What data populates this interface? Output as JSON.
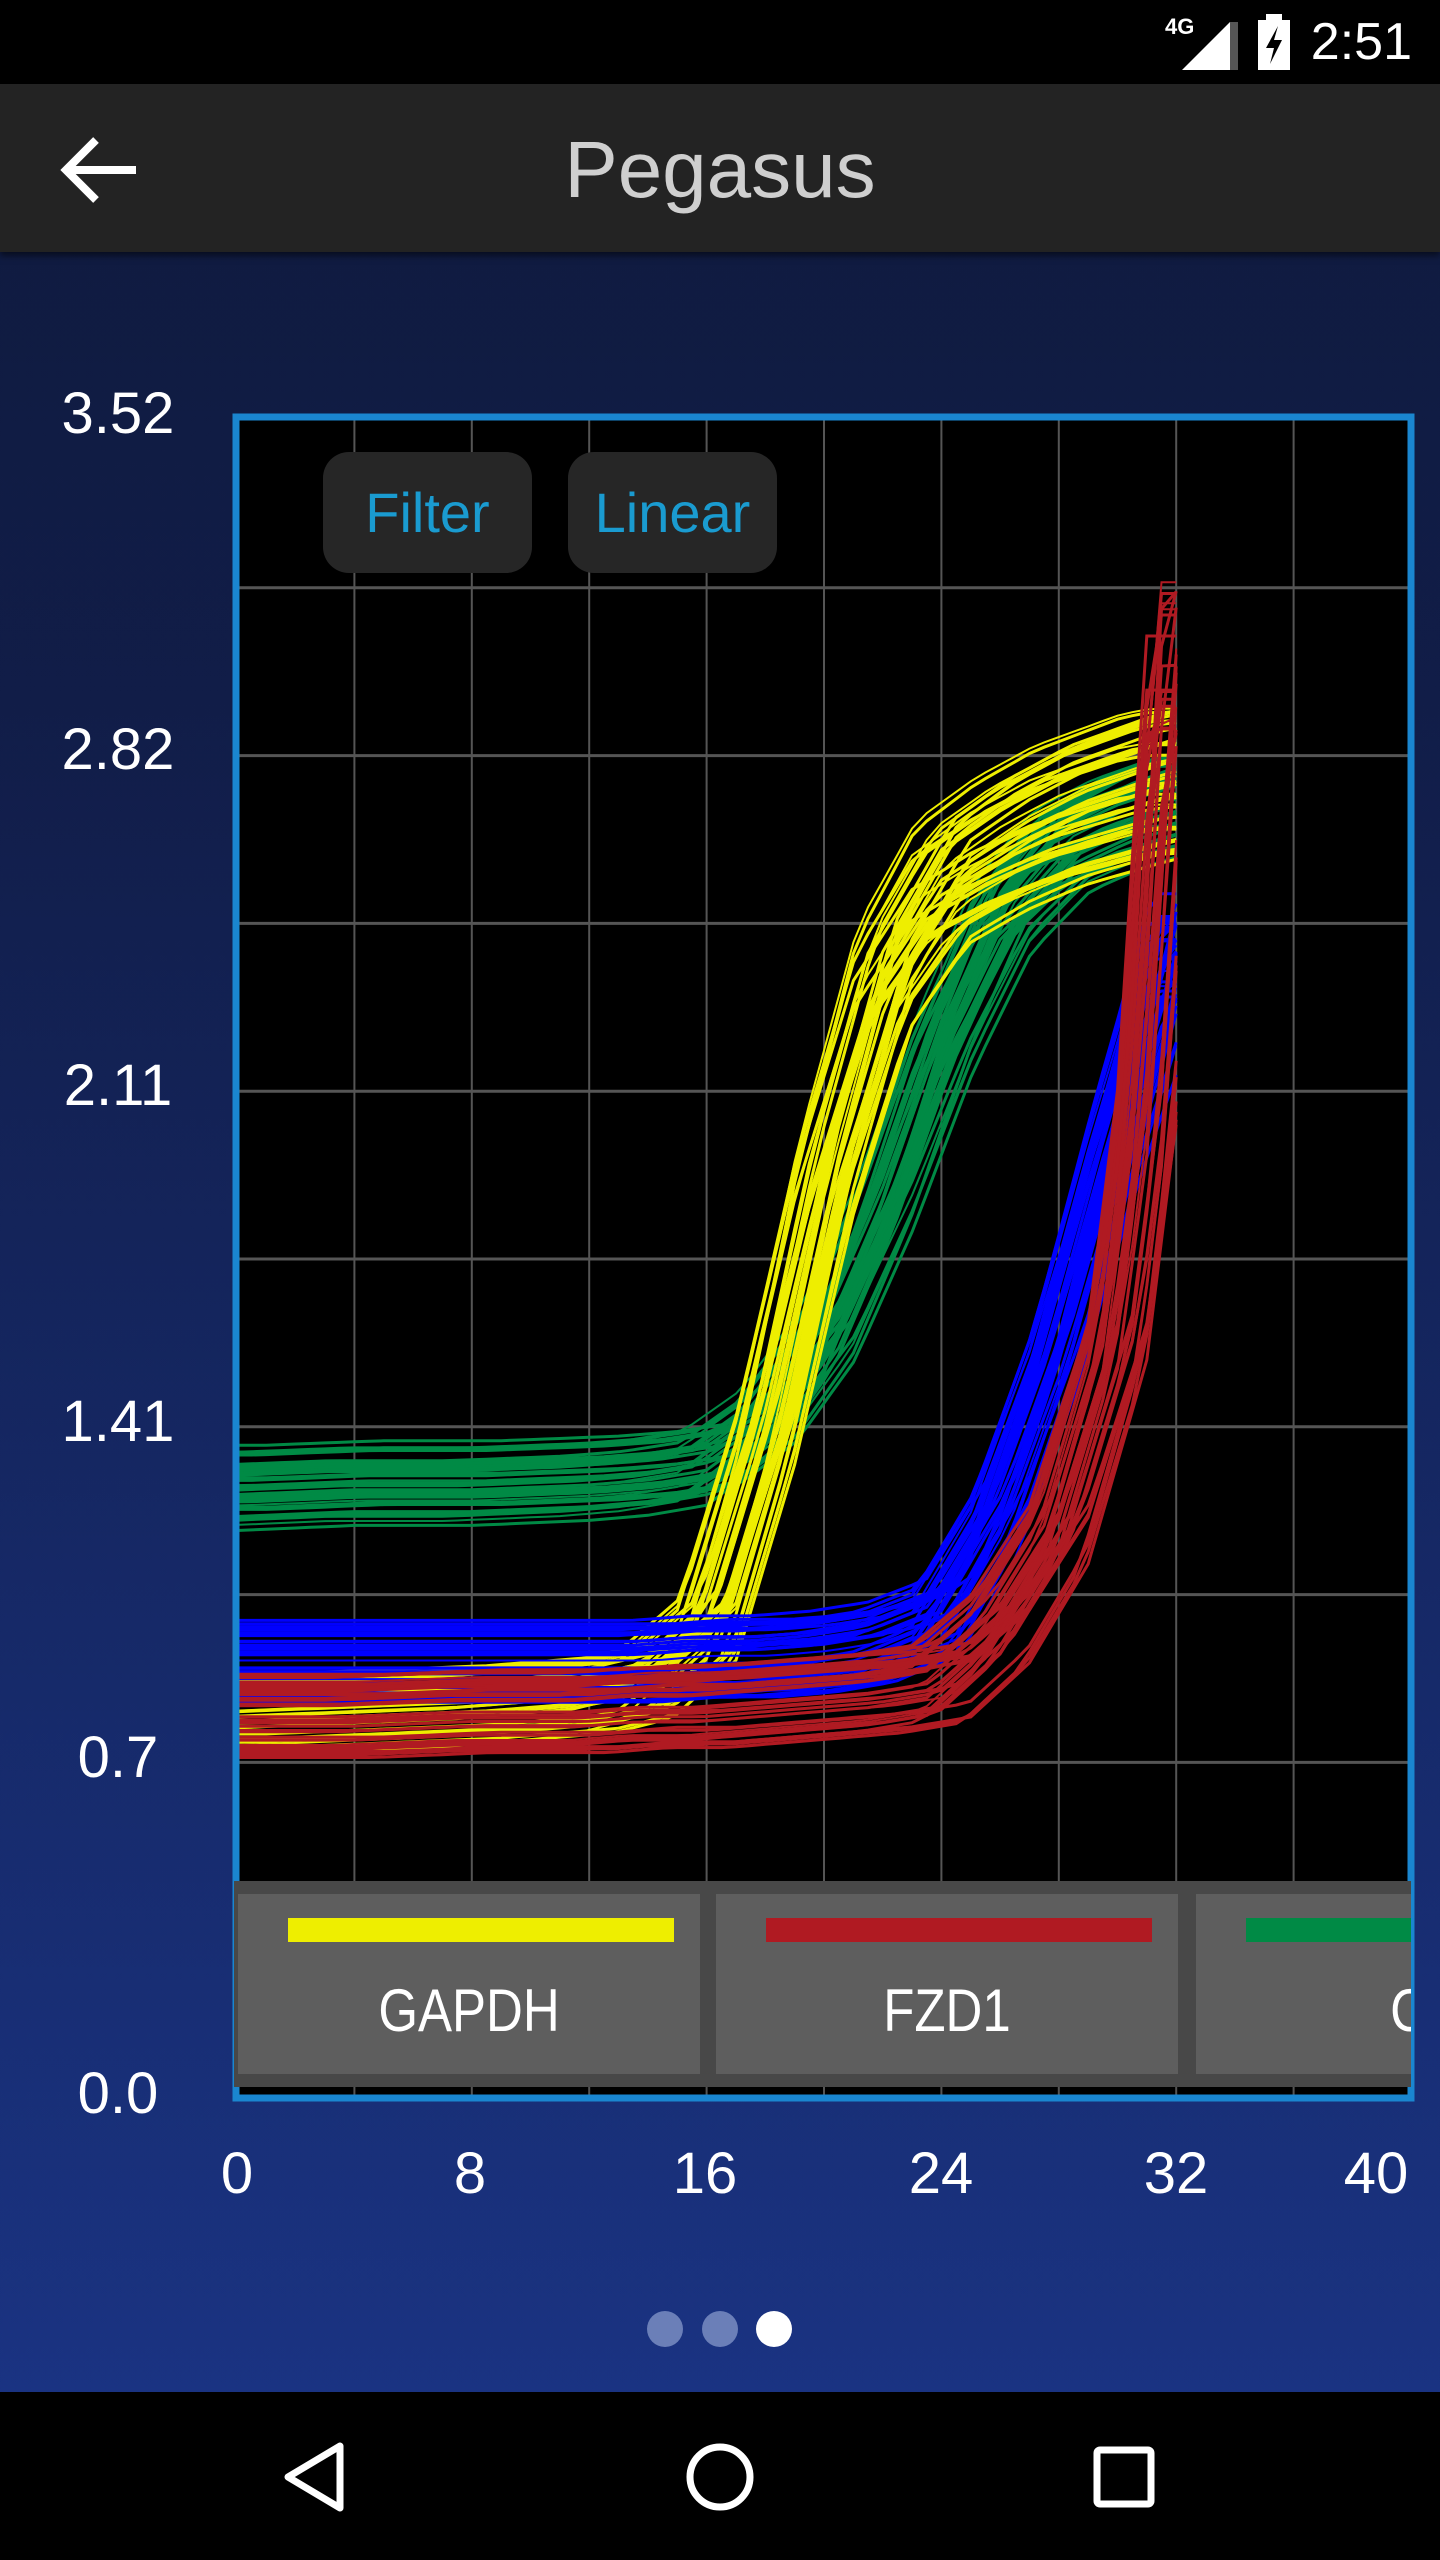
{
  "status_bar": {
    "network": "4G",
    "time": "2:51",
    "icons": [
      "signal-icon",
      "battery-charging-icon"
    ]
  },
  "app_bar": {
    "title": "Pegasus",
    "back_icon": "arrow-left-icon"
  },
  "controls": {
    "filter_label": "Filter",
    "scale_label": "Linear"
  },
  "legend": [
    {
      "label": "GAPDH",
      "color": "#eeee00"
    },
    {
      "label": "FZD1",
      "color": "#b01a22"
    },
    {
      "label": "CD",
      "color": "#008a45"
    }
  ],
  "pager": {
    "pages": 3,
    "current": 3
  },
  "nav_bar": {
    "icons": [
      "back-triangle-icon",
      "home-circle-icon",
      "recents-square-icon"
    ]
  },
  "chart_data": {
    "type": "line",
    "xlim": [
      0,
      40
    ],
    "ylim": [
      0,
      3.52
    ],
    "x_ticks": [
      "0",
      "8",
      "16",
      "24",
      "32",
      "40"
    ],
    "y_ticks": [
      "3.52",
      "2.82",
      "2.11",
      "1.41",
      "0.7",
      "0.0"
    ],
    "grid": true,
    "grid_x_step": 4,
    "grid_y_step": 0.352,
    "x": [
      0,
      4,
      8,
      12,
      14,
      16,
      18,
      20,
      22,
      24,
      26,
      28,
      30,
      31,
      32
    ],
    "series": [
      {
        "name": "CD",
        "color": "#008a45",
        "values": [
          1.28,
          1.29,
          1.29,
          1.3,
          1.31,
          1.33,
          1.42,
          1.59,
          1.87,
          2.21,
          2.48,
          2.62,
          2.68,
          2.7,
          2.72
        ]
      },
      {
        "name": "GAPDH",
        "color": "#eeee00",
        "values": [
          0.8,
          0.81,
          0.82,
          0.84,
          0.87,
          0.98,
          1.39,
          1.93,
          2.35,
          2.55,
          2.63,
          2.69,
          2.73,
          2.75,
          2.76
        ]
      },
      {
        "color": "#0000ff",
        "values": [
          0.92,
          0.92,
          0.92,
          0.92,
          0.92,
          0.93,
          0.93,
          0.94,
          0.96,
          1.01,
          1.22,
          1.56,
          2.0,
          2.2,
          2.41
        ]
      },
      {
        "name": "FZD1",
        "color": "#b01a22",
        "values": [
          0.8,
          0.8,
          0.81,
          0.81,
          0.82,
          0.82,
          0.83,
          0.84,
          0.85,
          0.87,
          0.98,
          1.18,
          1.59,
          2.07,
          3.03
        ]
      }
    ]
  }
}
